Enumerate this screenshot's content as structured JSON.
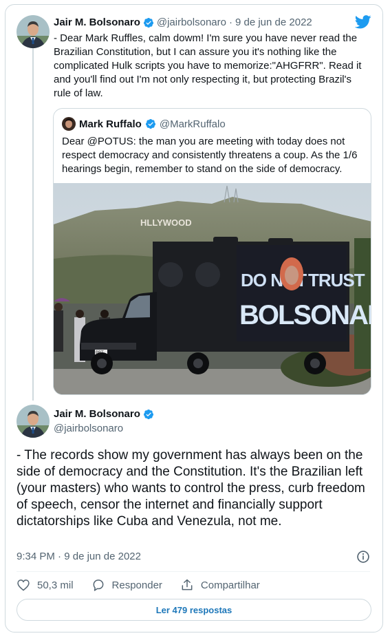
{
  "reply": {
    "author_name": "Jair M. Bolsonaro",
    "author_handle": "@jairbolsonaro",
    "separator": "·",
    "date": "9 de jun de 2022",
    "text": "- Dear Mark Ruffles, calm dowm! I'm sure you have never read the Brazilian Constitution, but I can assure you it's nothing like the complicated Hulk scripts you have to memorize:\"AHGFRR\". Read it and you'll find out I'm not only respecting it, but protecting Brazil's rule of law."
  },
  "quote": {
    "author_name": "Mark Ruffalo",
    "author_handle": "@MarkRuffalo",
    "text": "Dear @POTUS: the man you are meeting with today does not respect democracy and consistently threatens a coup. As the 1/6 hearings begin, remember to stand on the side of democracy.",
    "photo": {
      "sign_text": "HLLYWOOD",
      "truck_line1_left": "DO NOT",
      "truck_line1_right": "TRUST",
      "truck_line2": "BOLSONARO",
      "plate": "BBT"
    }
  },
  "main": {
    "author_name": "Jair M. Bolsonaro",
    "author_handle": "@jairbolsonaro",
    "text": "- The records show my government has always been on the side of democracy and the Constitution. It's the Brazilian left (your masters) who wants to control the press, curb freedom of speech, censor the internet and financially support dictatorships like Cuba and Venezula, not me.",
    "time": "9:34 PM",
    "separator": "·",
    "date": "9 de jun de 2022"
  },
  "actions": {
    "like_count": "50,3 mil",
    "reply_label": "Responder",
    "share_label": "Compartilhar"
  },
  "read_replies_label": "Ler 479 respostas",
  "colors": {
    "twitter_blue": "#1d9bf0",
    "text": "#0f1419",
    "muted": "#536471",
    "border": "#cfd9de",
    "link_button": "#1d77b9"
  },
  "icons": [
    "twitter-bird-icon",
    "verified-badge-icon",
    "info-icon",
    "heart-icon",
    "reply-bubble-icon",
    "share-icon"
  ]
}
